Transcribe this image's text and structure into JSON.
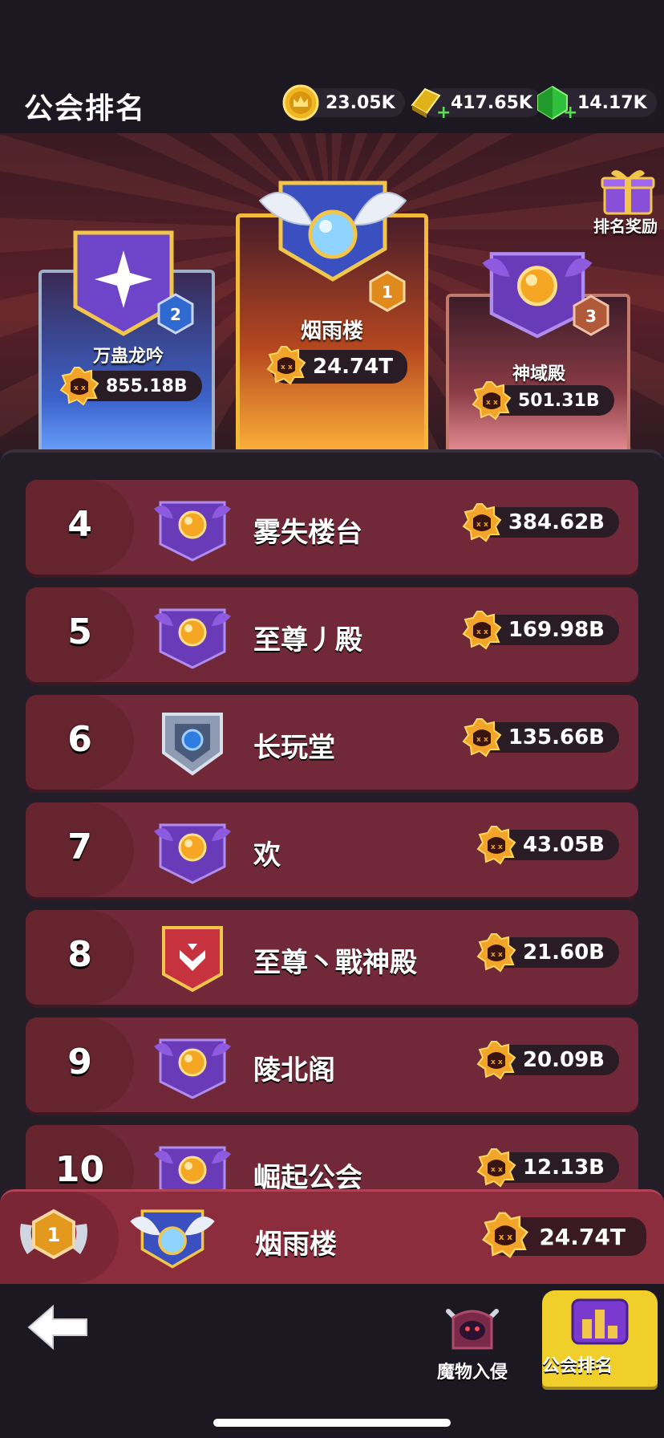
{
  "header": {
    "title": "公会排名",
    "currencies": [
      {
        "icon": "crown-coin-icon",
        "value": "23.05K"
      },
      {
        "icon": "gold-bar-icon",
        "value": "417.65K"
      },
      {
        "icon": "green-gem-icon",
        "value": "14.17K"
      }
    ]
  },
  "reward": {
    "label": "排名奖励",
    "icon": "gift-box-icon"
  },
  "podium": [
    {
      "rank": "1",
      "name": "烟雨楼",
      "score": "24.74T"
    },
    {
      "rank": "2",
      "name": "万蛊龙吟",
      "score": "855.18B"
    },
    {
      "rank": "3",
      "name": "神域殿",
      "score": "501.31B"
    }
  ],
  "list": [
    {
      "rank": "4",
      "name": "雾失楼台",
      "score": "384.62B",
      "emblem": "purple-wing-emblem-icon"
    },
    {
      "rank": "5",
      "name": "至尊丿殿",
      "score": "169.98B",
      "emblem": "purple-wing-emblem-icon"
    },
    {
      "rank": "6",
      "name": "长玩堂",
      "score": "135.66B",
      "emblem": "silver-shield-emblem-icon"
    },
    {
      "rank": "7",
      "name": "欢",
      "score": "43.05B",
      "emblem": "purple-wing-emblem-icon"
    },
    {
      "rank": "8",
      "name": "至尊丶戰神殿",
      "score": "21.60B",
      "emblem": "red-banner-emblem-icon"
    },
    {
      "rank": "9",
      "name": "陵北阁",
      "score": "20.09B",
      "emblem": "purple-wing-emblem-icon"
    },
    {
      "rank": "10",
      "name": "崛起公会",
      "score": "12.13B",
      "emblem": "purple-wing-emblem-icon"
    }
  ],
  "my_guild": {
    "rank": "1",
    "name": "烟雨楼",
    "score": "24.74T"
  },
  "nav": {
    "back_icon": "back-arrow-icon",
    "items": [
      {
        "label": "魔物入侵",
        "icon": "monster-invasion-icon",
        "active": false
      },
      {
        "label": "公会排名",
        "icon": "guild-ranking-icon",
        "active": true
      }
    ]
  },
  "colors": {
    "row": "#712838",
    "gold": "#f2b93b",
    "active_tab": "#f0cf2a"
  }
}
